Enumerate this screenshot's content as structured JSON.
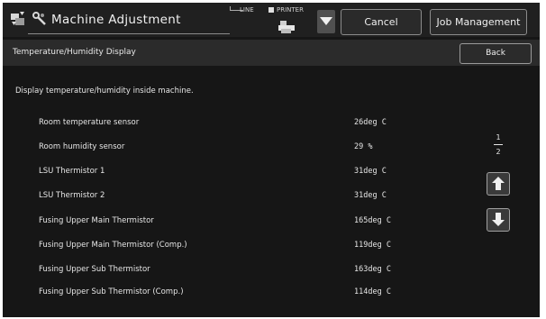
{
  "header": {
    "title": "Machine Adjustment",
    "line_label": "LINE",
    "printer_label": "PRINTER",
    "cancel_label": "Cancel",
    "job_management_label": "Job Management"
  },
  "subheader": {
    "title": "Temperature/Humidity Display",
    "back_label": "Back"
  },
  "main": {
    "description": "Display temperature/humidity inside machine.",
    "rows": [
      {
        "label": "Room temperature sensor",
        "value": "26deg C"
      },
      {
        "label": "Room humidity sensor",
        "value": "29 %"
      },
      {
        "label": "LSU Thermistor 1",
        "value": "31deg C"
      },
      {
        "label": "LSU Thermistor 2",
        "value": "31deg C"
      },
      {
        "label": "Fusing Upper Main Thermistor",
        "value": "165deg C"
      },
      {
        "label": "Fusing Upper Main Thermistor (Comp.)",
        "value": "119deg C"
      },
      {
        "label": "Fusing Upper Sub Thermistor",
        "value": "163deg C"
      },
      {
        "label": "Fusing Upper Sub Thermistor (Comp.)",
        "value": "114deg C"
      }
    ]
  },
  "pager": {
    "current": "1",
    "total": "2"
  },
  "icons": {
    "app": "machine-settings-icon",
    "wrench": "wrench-icon",
    "printer": "printer-icon",
    "dropdown": "triangle-down-icon",
    "up": "arrow-up-icon",
    "down": "arrow-down-icon"
  }
}
